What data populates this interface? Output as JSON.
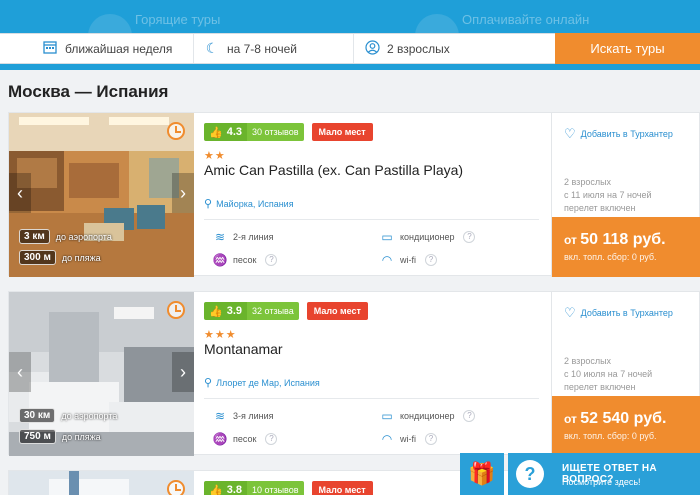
{
  "topbar": {
    "left_text": "Горящие туры",
    "right_text": "Оплачивайте онлайн"
  },
  "search": {
    "date": "ближайшая неделя",
    "nights": "на 7-8 ночей",
    "tourists": "2 взрослых",
    "button": "Искать туры"
  },
  "route": "Москва — Испания",
  "cards": [
    {
      "rating": "4.3",
      "reviews": "30 отзывов",
      "badge": "Мало мест",
      "stars": "★★",
      "name": "Amic Can Pastilla (ex. Can Pastilla Playa)",
      "location": "Майорка, Испания",
      "line": "2-я линия",
      "beach": "песок",
      "ac": "кондиционер",
      "wifi": "wi-fi",
      "dist_airport": "3 км",
      "dist_airport_label": "до аэропорта",
      "dist_beach": "300 м",
      "dist_beach_label": "до пляжа",
      "fav": "Добавить в Турхантер",
      "trip1": "2 взрослых",
      "trip2": "с 11 июля на 7 ночей",
      "trip3": "перелет включен",
      "price_from": "от",
      "price": "50 118 руб.",
      "price_note": "вкл. топл. сбор: 0 руб."
    },
    {
      "rating": "3.9",
      "reviews": "32 отзыва",
      "badge": "Мало мест",
      "stars": "★★★",
      "name": "Montanamar",
      "location": "Ллорет де Мар, Испания",
      "line": "3-я линия",
      "beach": "песок",
      "ac": "кондиционер",
      "wifi": "wi-fi",
      "dist_airport": "30 км",
      "dist_airport_label": "до аэропорта",
      "dist_beach": "750 м",
      "dist_beach_label": "до пляжа",
      "fav": "Добавить в Турхантер",
      "trip1": "2 взрослых",
      "trip2": "с 10 июля на 7 ночей",
      "trip3": "перелет включен",
      "price_from": "от",
      "price": "52 540 руб.",
      "price_note": "вкл. топл. сбор: 0 руб."
    },
    {
      "rating": "3.8",
      "reviews": "10 отзывов",
      "badge": "Мало мест"
    }
  ],
  "help": {
    "title": "ИЩЕТЕ ОТВЕТ НА ВОПРОС?",
    "subtitle": "Посмотрите здесь!"
  },
  "colors": {
    "accent": "#f08c2e",
    "primary": "#1f9fd8",
    "rating": "#6ab42c",
    "badge": "#e8442e"
  }
}
